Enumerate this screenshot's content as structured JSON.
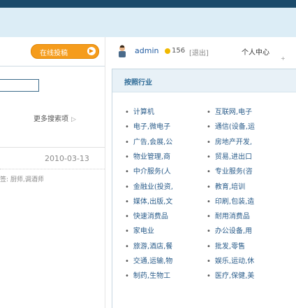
{
  "header": {
    "post_button": "在线投稿",
    "go_glyph": "▶"
  },
  "left": {
    "search_value": "",
    "advanced_search": "更多搜索项",
    "advanced_arrow": "▷",
    "date": "2010-03-13",
    "tags": "签: 厨师,调酒师"
  },
  "userbar": {
    "username": "admin",
    "credits": "156",
    "logout": "[退出]",
    "user_center": "个人中心",
    "plus": "+"
  },
  "panel": {
    "title": "按照行业",
    "bullet": "•",
    "col1": [
      "计算机",
      "电子,微电子",
      "广告,会展,公",
      "物业管理,商",
      "中介服务(人",
      "金融业(投资,",
      "媒体,出版,文",
      "快速消费品",
      "家电业",
      "旅游,酒店,餐",
      "交通,运输,物",
      "制药,生物工"
    ],
    "col2": [
      "互联网,电子",
      "通信(设备,运",
      "房地产开发,",
      "贸易,进出口",
      "专业服务(咨",
      "教育,培训",
      "印刷,包装,造",
      "耐用消费品",
      "办公设备,用",
      "批发,零售",
      "娱乐,运动,休",
      "医疗,保健,美"
    ]
  },
  "colors": {
    "topbar": "#1a4a6a",
    "banner": "#dcedf6",
    "button": "#f59c1c",
    "link": "#2a5c8a",
    "panel_head": "#e8f1f7"
  }
}
